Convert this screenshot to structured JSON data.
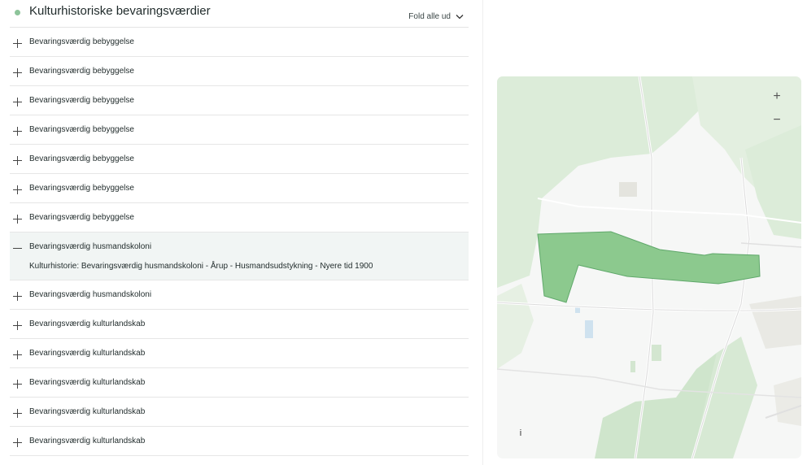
{
  "section": {
    "title": "Kulturhistoriske bevaringsværdier",
    "fold_all_label": "Fold alle ud"
  },
  "rows": [
    {
      "label": "Bevaringsværdig bebyggelse",
      "expanded": false,
      "icon": "plus-icon"
    },
    {
      "label": "Bevaringsværdig bebyggelse",
      "expanded": false,
      "icon": "plus-icon"
    },
    {
      "label": "Bevaringsværdig bebyggelse",
      "expanded": false,
      "icon": "plus-icon"
    },
    {
      "label": "Bevaringsværdig bebyggelse",
      "expanded": false,
      "icon": "plus-icon"
    },
    {
      "label": "Bevaringsværdig bebyggelse",
      "expanded": false,
      "icon": "plus-icon"
    },
    {
      "label": "Bevaringsværdig bebyggelse",
      "expanded": false,
      "icon": "plus-icon"
    },
    {
      "label": "Bevaringsværdig bebyggelse",
      "expanded": false,
      "icon": "plus-icon"
    },
    {
      "label": "Bevaringsværdig husmandskoloni",
      "expanded": true,
      "icon": "minus-icon",
      "detail": "Kulturhistorie: Bevaringsværdig husmandskoloni - Årup - Husmandsudstykning - Nyere tid 1900"
    },
    {
      "label": "Bevaringsværdig husmandskoloni",
      "expanded": false,
      "icon": "plus-icon"
    },
    {
      "label": "Bevaringsværdig kulturlandskab",
      "expanded": false,
      "icon": "plus-icon"
    },
    {
      "label": "Bevaringsværdig kulturlandskab",
      "expanded": false,
      "icon": "plus-icon"
    },
    {
      "label": "Bevaringsværdig kulturlandskab",
      "expanded": false,
      "icon": "plus-icon"
    },
    {
      "label": "Bevaringsværdig kulturlandskab",
      "expanded": false,
      "icon": "plus-icon"
    },
    {
      "label": "Bevaringsværdig kulturlandskab",
      "expanded": false,
      "icon": "plus-icon"
    }
  ],
  "map": {
    "zoom_in_label": "+",
    "zoom_out_label": "−",
    "info_label": "i"
  },
  "colors": {
    "status_dot": "#8dc49a",
    "polygon_fill": "#8cc98e",
    "polygon_stroke": "#5fa86a",
    "forest": "#dcecd9",
    "road": "#ffffff",
    "water": "#cfe2ef"
  }
}
